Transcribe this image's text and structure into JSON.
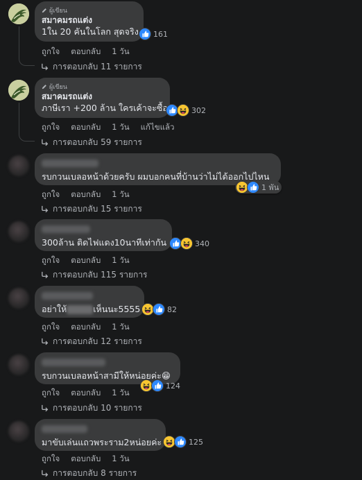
{
  "colors": {
    "background": "#18191a",
    "bubble": "#3a3b3c",
    "like": "#2e89ff",
    "haha": "#f7c531"
  },
  "ui": {
    "like_label": "ถูกใจ",
    "reply_label": "ตอบกลับ",
    "edited_label": "แก้ไขแล้ว",
    "author_badge": "ผู้เขียน"
  },
  "comments": [
    {
      "author": "สมาคมรถแต่ง",
      "text": "1ใน 20 คันในโลก สุดจริง",
      "reactions": [
        "like"
      ],
      "count": "161",
      "time": "1 วัน",
      "replies": "การตอบกลับ 11 รายการ"
    },
    {
      "author": "สมาคมรถแต่ง",
      "text": "ภาษีเรา +200 ล้าน ใครเค้าจะซื้อ",
      "reactions": [
        "like",
        "haha"
      ],
      "count": "302",
      "time": "1 วัน",
      "edited": true,
      "replies": "การตอบกลับ 59 รายการ"
    },
    {
      "author": "",
      "text": "รบกวนเบลอหน้าด้วยครับ ผมบอกคนที่บ้านว่าไม่ได้ออกไปไหน",
      "reactions": [
        "haha",
        "like"
      ],
      "count": "1 พัน",
      "time": "1 วัน",
      "replies": "การตอบกลับ 15 รายการ"
    },
    {
      "author": "",
      "text": "300ล้าน ติดไฟแดง10นาทีเท่ากัน",
      "reactions": [
        "like",
        "haha"
      ],
      "count": "340",
      "time": "1 วัน",
      "replies": "การตอบกลับ 115 รายการ"
    },
    {
      "author": "",
      "text_pre": "อย่าให้",
      "text_post": "เห็นนะ5555",
      "reactions": [
        "haha",
        "like"
      ],
      "count": "82",
      "time": "1 วัน",
      "replies": "การตอบกลับ 12 รายการ"
    },
    {
      "author": "",
      "text": "รบกวนเบลอหน้าสามีให้หน่อยค่ะ😁",
      "reactions": [
        "haha",
        "like"
      ],
      "count": "124",
      "time": "1 วัน",
      "replies": "การตอบกลับ 10 รายการ"
    },
    {
      "author": "",
      "text": "มาขับเล่นแถวพระราม2หน่อยค่ะ",
      "reactions": [
        "haha",
        "like"
      ],
      "count": "125",
      "time": "1 วัน",
      "replies": "การตอบกลับ 8 รายการ"
    }
  ]
}
